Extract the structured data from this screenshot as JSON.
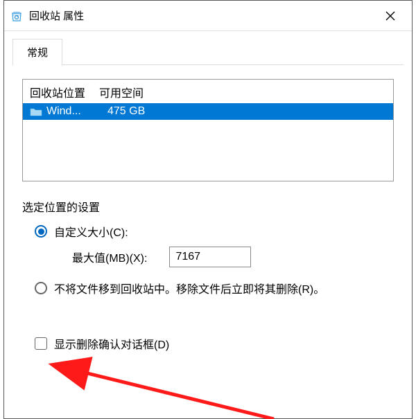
{
  "window": {
    "title": "回收站 属性"
  },
  "tabs": {
    "general": "常规"
  },
  "listbox": {
    "header_location": "回收站位置",
    "header_space": "可用空间",
    "rows": [
      {
        "name": "Wind...",
        "space": "475 GB"
      }
    ]
  },
  "settings": {
    "section_title": "选定位置的设置",
    "custom_size_label": "自定义大小(C):",
    "max_size_label": "最大值(MB)(X):",
    "max_size_value": "7167",
    "no_recycle_label": "不将文件移到回收站中。移除文件后立即将其删除(R)。"
  },
  "confirm": {
    "label": "显示删除确认对话框(D)"
  }
}
